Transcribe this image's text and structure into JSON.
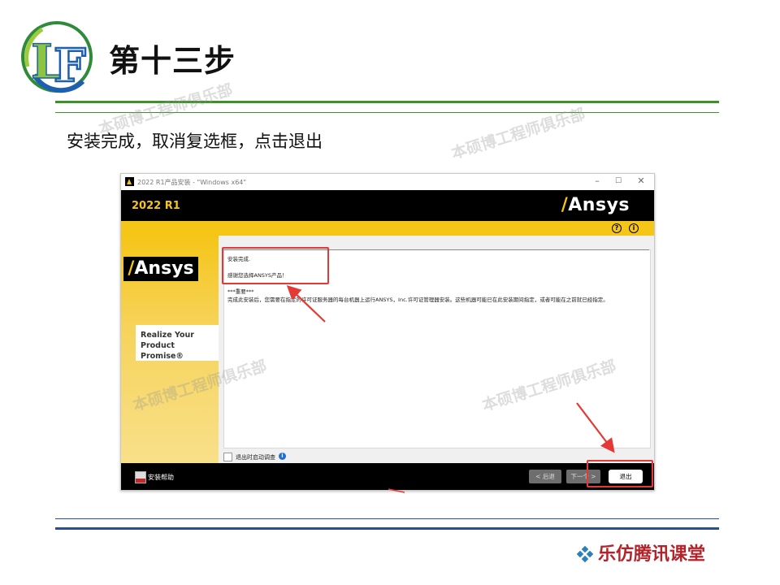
{
  "slide": {
    "title": "第十三步",
    "instruction": "安装完成，取消复选框，点击退出",
    "logo_text": "LF",
    "watermark": "本硕博工程师俱乐部",
    "brand": "乐仿腾讯课堂"
  },
  "window": {
    "title": "2022 R1产品安装 - \"Windows x64\"",
    "controls": {
      "minimize": "–",
      "maximize": "☐",
      "close": "✕"
    },
    "version": "2022 R1",
    "logo_top": "Ansys",
    "header_icons": [
      "help-icon",
      "info-icon"
    ],
    "header_glyphs": {
      "help": "?",
      "info": "i"
    },
    "sidebar": {
      "logo": "Ansys",
      "tagline_line1": "Realize Your",
      "tagline_line2": "Product Promise®"
    },
    "content": {
      "line1": "安装完成.",
      "line2": "感谢您选择ANSYS产品！",
      "line3": "***重要***",
      "line4": "完成此安装后，您需要在指定的许可证服务器的每台机器上运行ANSYS，Inc.许可证管理器安装。这些机器可能已在此安装期间指定，或者可能在之前就已经指定。"
    },
    "checkbox_label": "退出时启动调查",
    "checkbox_checked": false,
    "footer": {
      "help": "安装帮助",
      "back": "< 后退",
      "next": "下一个 >",
      "exit": "退出"
    }
  },
  "colors": {
    "ansys_yellow": "#f5c518",
    "green_rule": "#3f8f2a",
    "blue_rule": "#2a4f8f",
    "annotation_red": "#e53935",
    "brand_red": "#b4232a"
  }
}
